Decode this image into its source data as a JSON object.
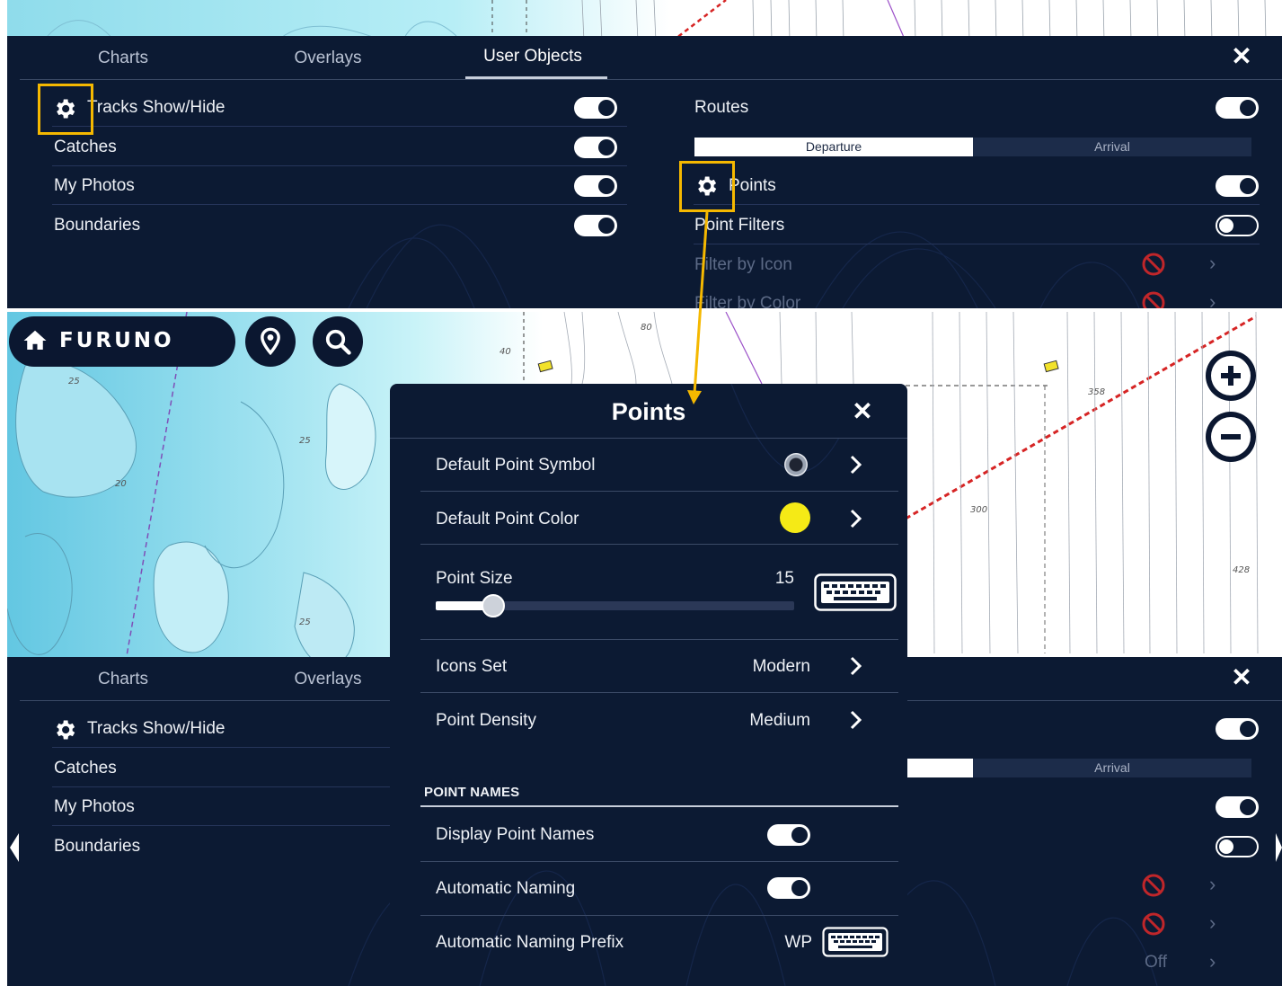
{
  "top_panel": {
    "tabs": [
      {
        "label": "Charts"
      },
      {
        "label": "Overlays"
      },
      {
        "label": "User Objects"
      }
    ],
    "left_rows": [
      {
        "label": "Tracks Show/Hide",
        "toggle": "on"
      },
      {
        "label": "Catches",
        "toggle": "on"
      },
      {
        "label": "My Photos",
        "toggle": "on"
      },
      {
        "label": "Boundaries",
        "toggle": "on"
      }
    ],
    "right_rows": {
      "routes": {
        "label": "Routes",
        "toggle": "on"
      },
      "segment": {
        "departure": "Departure",
        "arrival": "Arrival"
      },
      "points": {
        "label": "Points",
        "toggle": "on"
      },
      "point_filters": {
        "label": "Point Filters",
        "toggle": "off"
      },
      "filter_by_icon": {
        "label": "Filter by Icon"
      },
      "filter_by_color": {
        "label": "Filter by Color"
      }
    }
  },
  "topbar": {
    "brand": "FURUNO",
    "icons": [
      "home-icon",
      "location-pin-icon",
      "search-icon",
      "zoom-in-icon",
      "zoom-out-icon"
    ]
  },
  "map_labels": {
    "depth_80": "80",
    "depth_40": "40",
    "depth_25a": "25",
    "depth_25b": "25",
    "depth_25c": "25",
    "depth_20": "20",
    "depth_358": "358",
    "depth_300": "300",
    "depth_428": "428"
  },
  "points_dialog": {
    "title": "Points",
    "default_symbol_label": "Default Point Symbol",
    "default_color_label": "Default Point Color",
    "default_color": "#f5ea16",
    "point_size_label": "Point Size",
    "point_size_value": "15",
    "point_size_fraction": 0.16,
    "icons_set_label": "Icons Set",
    "icons_set_value": "Modern",
    "point_density_label": "Point Density",
    "point_density_value": "Medium",
    "section_point_names": "POINT NAMES",
    "display_point_names_label": "Display Point Names",
    "display_point_names": "on",
    "automatic_naming_label": "Automatic Naming",
    "automatic_naming": "on",
    "automatic_naming_prefix_label": "Automatic Naming Prefix",
    "automatic_naming_prefix_value": "WP"
  },
  "bottom_panel": {
    "tabs": [
      {
        "label": "Charts"
      },
      {
        "label": "Overlays"
      }
    ],
    "left_rows": [
      {
        "label": "Tracks Show/Hide"
      },
      {
        "label": "Catches"
      },
      {
        "label": "My Photos"
      },
      {
        "label": "Boundaries"
      }
    ],
    "arrival_label": "Arrival",
    "off_label": "Off"
  },
  "colors": {
    "panel": "#0c1a33",
    "highlight": "#f5b800",
    "noentry": "#c0262a"
  }
}
